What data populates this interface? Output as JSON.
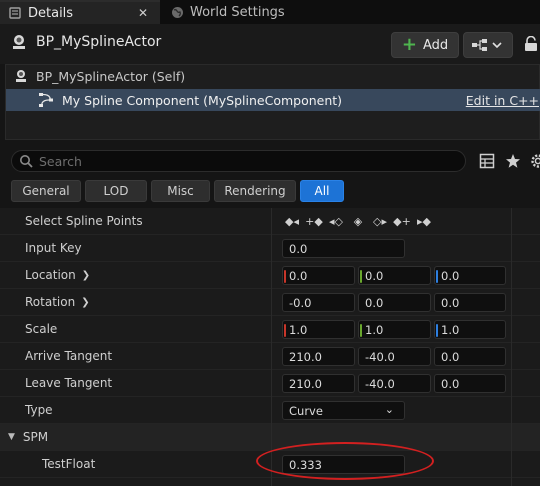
{
  "tabs": [
    {
      "label": "Details",
      "icon": "details-icon",
      "active": true
    },
    {
      "label": "World Settings",
      "icon": "globe-icon",
      "active": false
    }
  ],
  "header": {
    "title": "BP_MySplineActor",
    "add_label": "Add",
    "icons": [
      "actor-icon",
      "blueprint-icon",
      "lock-icon"
    ]
  },
  "tree": {
    "self_label": "BP_MySplineActor (Self)",
    "component_label": "My Spline Component (MySplineComponent)",
    "edit_link": "Edit in C++"
  },
  "search": {
    "placeholder": "Search"
  },
  "filters": [
    "General",
    "LOD",
    "Misc",
    "Rendering",
    "All"
  ],
  "active_filter": "All",
  "properties": {
    "select_spline_points": {
      "label": "Select Spline Points"
    },
    "input_key": {
      "label": "Input Key",
      "value": "0.0"
    },
    "location": {
      "label": "Location",
      "x": "0.0",
      "y": "0.0",
      "z": "0.0"
    },
    "rotation": {
      "label": "Rotation",
      "x": "-0.0",
      "y": "0.0",
      "z": "0.0"
    },
    "scale": {
      "label": "Scale",
      "x": "1.0",
      "y": "1.0",
      "z": "1.0"
    },
    "arrive_tangent": {
      "label": "Arrive Tangent",
      "x": "210.0",
      "y": "-40.0",
      "z": "0.0"
    },
    "leave_tangent": {
      "label": "Leave Tangent",
      "x": "210.0",
      "y": "-40.0",
      "z": "0.0"
    },
    "type": {
      "label": "Type",
      "value": "Curve"
    },
    "spm": {
      "label": "SPM"
    },
    "test_float": {
      "label": "TestFloat",
      "value": "0.333"
    }
  },
  "colors": {
    "x_axis": "#c8362a",
    "y_axis": "#6aa82e",
    "z_axis": "#2d7fe0",
    "active_filter": "#1d73d6",
    "selected_row": "#38485c",
    "annotation": "#d32020"
  }
}
